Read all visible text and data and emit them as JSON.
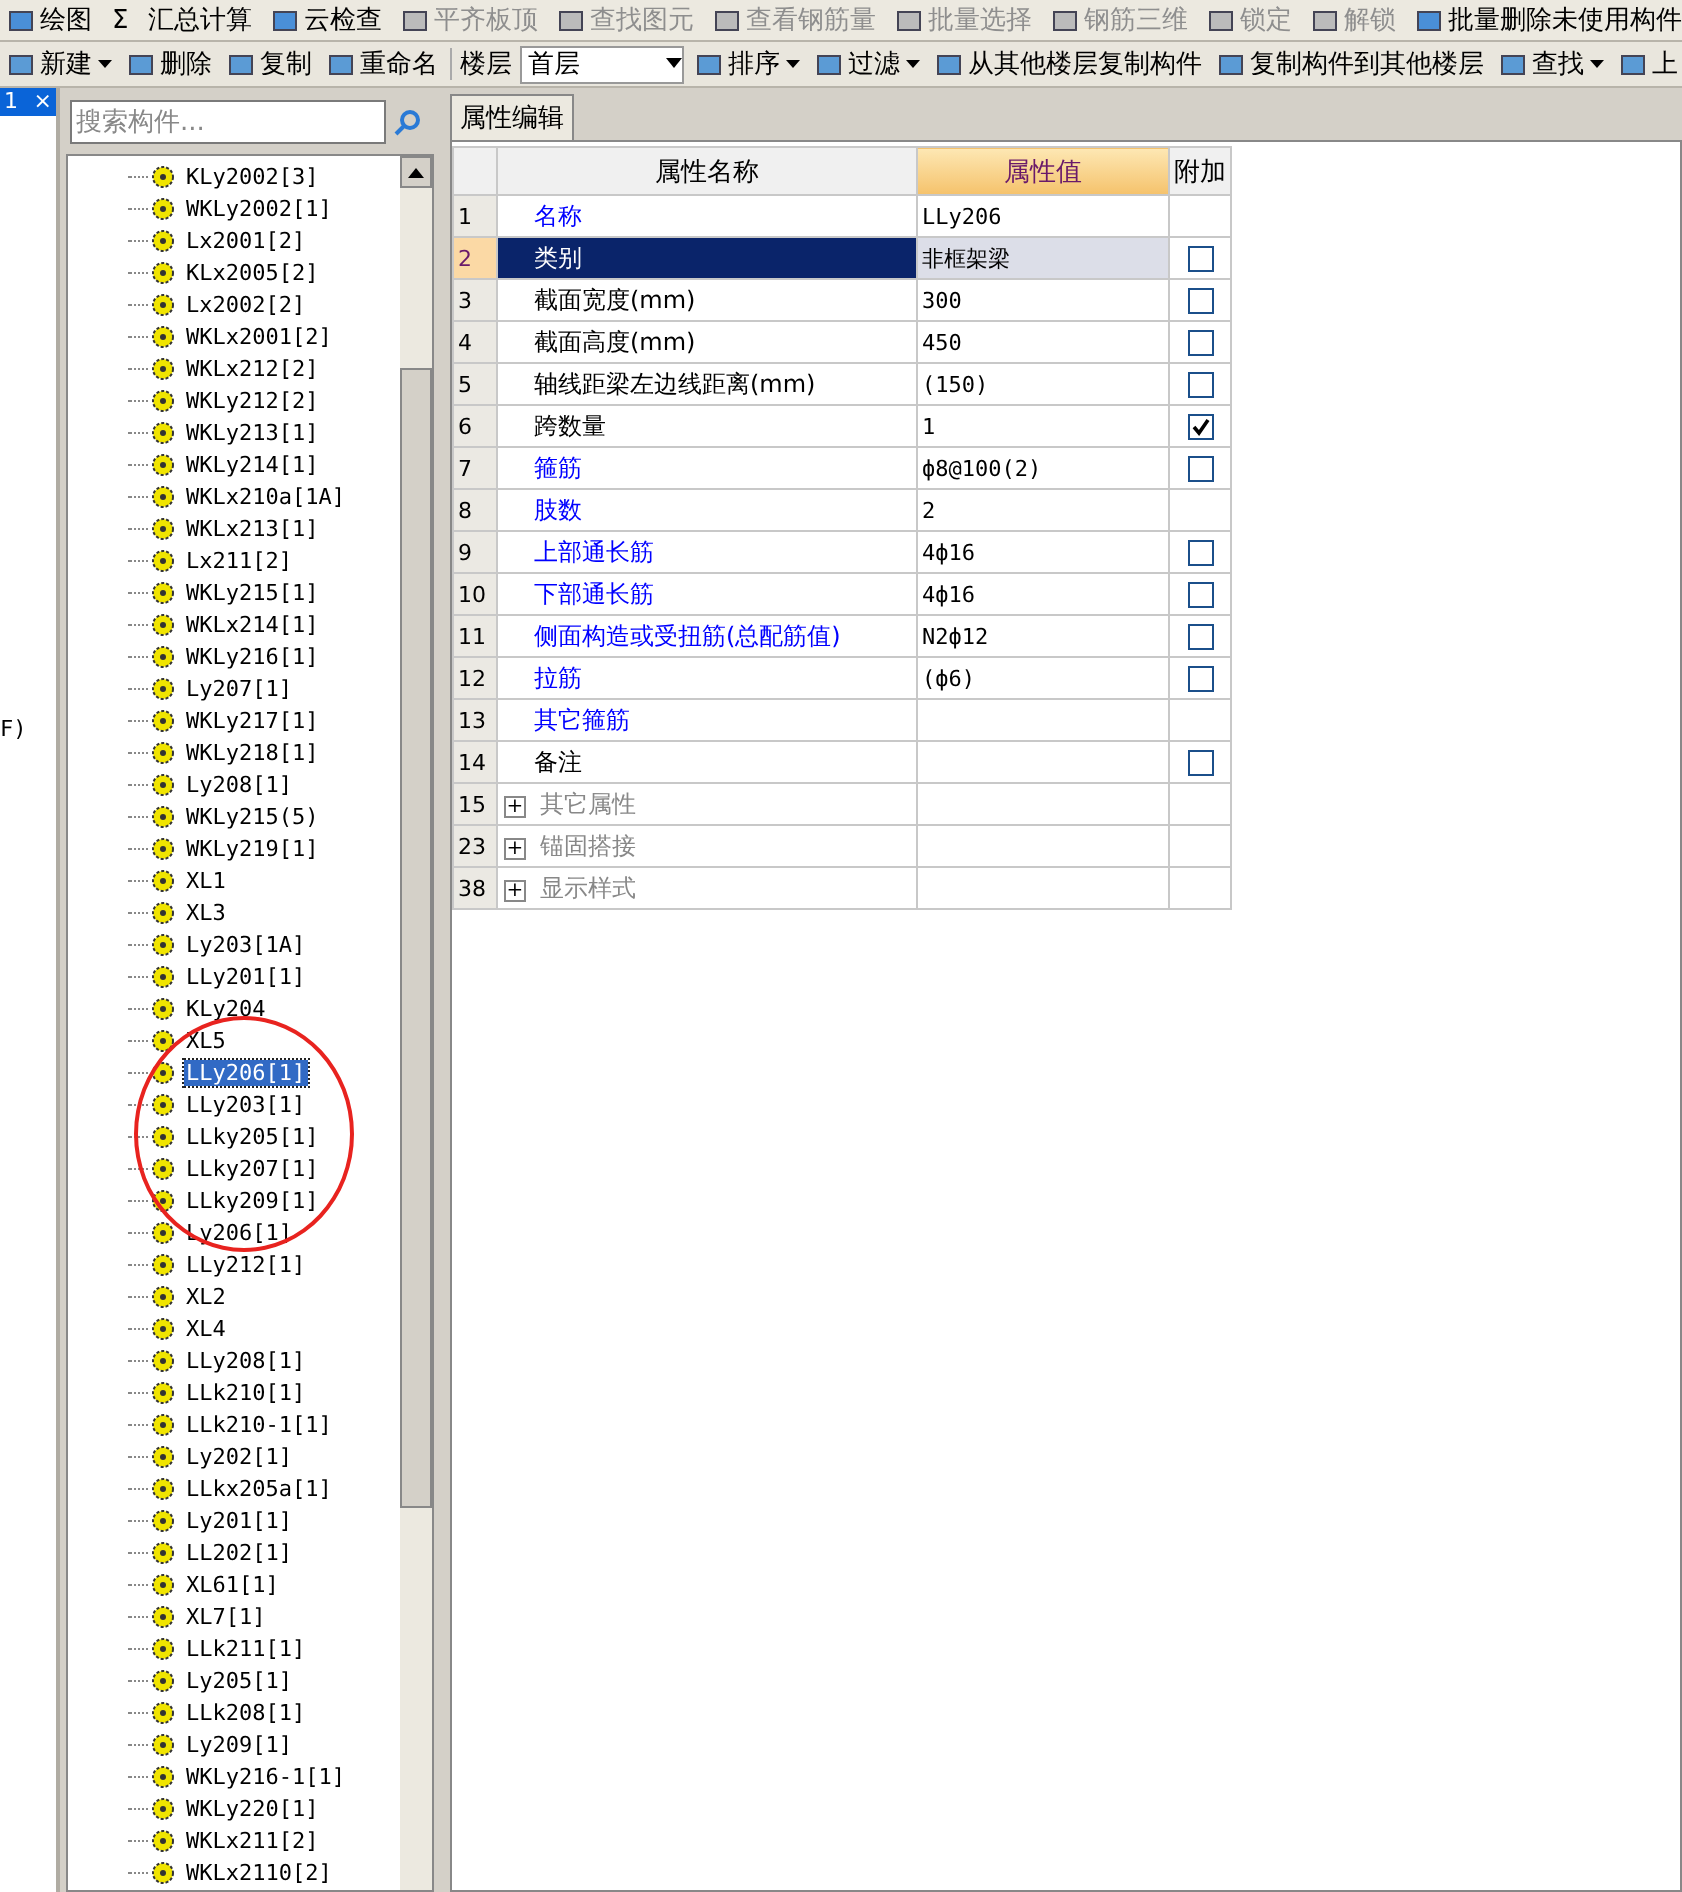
{
  "toolbar_top": [
    {
      "label": "绘图",
      "disabled": false
    },
    {
      "label": "Σ",
      "disabled": false,
      "kind": "glyph"
    },
    {
      "label": "汇总计算",
      "disabled": false
    },
    {
      "label": "云检查",
      "disabled": false
    },
    {
      "label": "平齐板顶",
      "disabled": true
    },
    {
      "label": "查找图元",
      "disabled": true
    },
    {
      "label": "查看钢筋量",
      "disabled": true
    },
    {
      "label": "批量选择",
      "disabled": true
    },
    {
      "label": "钢筋三维",
      "disabled": true
    },
    {
      "label": "锁定",
      "disabled": true
    },
    {
      "label": "解锁",
      "disabled": true
    },
    {
      "label": "批量删除未使用构件",
      "disabled": false
    }
  ],
  "toolbar": [
    {
      "label": "新建",
      "dropdown": true
    },
    {
      "label": "删除",
      "dropdown": false
    },
    {
      "label": "复制",
      "dropdown": false
    },
    {
      "label": "重命名",
      "dropdown": false
    },
    {
      "label": "楼层",
      "kind": "label"
    },
    {
      "label": "首层",
      "kind": "select"
    },
    {
      "label": "排序",
      "dropdown": true
    },
    {
      "label": "过滤",
      "dropdown": true
    },
    {
      "label": "从其他楼层复制构件",
      "dropdown": false
    },
    {
      "label": "复制构件到其他楼层",
      "dropdown": false
    },
    {
      "label": "查找",
      "dropdown": true
    },
    {
      "label": "上",
      "dropdown": false
    }
  ],
  "side_panel": {
    "tab": "1",
    "close": "×",
    "text": "F)"
  },
  "search": {
    "placeholder": "搜索构件..."
  },
  "tree_items": [
    {
      "label": "KLy2002[3]",
      "selected": false
    },
    {
      "label": "WKLy2002[1]",
      "selected": false
    },
    {
      "label": "Lx2001[2]",
      "selected": false
    },
    {
      "label": "KLx2005[2]",
      "selected": false
    },
    {
      "label": "Lx2002[2]",
      "selected": false
    },
    {
      "label": "WKLx2001[2]",
      "selected": false
    },
    {
      "label": "WKLx212[2]",
      "selected": false
    },
    {
      "label": "WKLy212[2]",
      "selected": false
    },
    {
      "label": "WKLy213[1]",
      "selected": false
    },
    {
      "label": "WKLy214[1]",
      "selected": false
    },
    {
      "label": "WKLx210a[1A]",
      "selected": false
    },
    {
      "label": "WKLx213[1]",
      "selected": false
    },
    {
      "label": "Lx211[2]",
      "selected": false
    },
    {
      "label": "WKLy215[1]",
      "selected": false
    },
    {
      "label": "WKLx214[1]",
      "selected": false
    },
    {
      "label": "WKLy216[1]",
      "selected": false
    },
    {
      "label": "Ly207[1]",
      "selected": false
    },
    {
      "label": "WKLy217[1]",
      "selected": false
    },
    {
      "label": "WKLy218[1]",
      "selected": false
    },
    {
      "label": "Ly208[1]",
      "selected": false
    },
    {
      "label": "WKLy215(5)",
      "selected": false
    },
    {
      "label": "WKLy219[1]",
      "selected": false
    },
    {
      "label": "XL1",
      "selected": false
    },
    {
      "label": "XL3",
      "selected": false
    },
    {
      "label": "Ly203[1A]",
      "selected": false
    },
    {
      "label": "LLy201[1]",
      "selected": false
    },
    {
      "label": "KLy204",
      "selected": false
    },
    {
      "label": "XL5",
      "selected": false
    },
    {
      "label": "LLy206[1]",
      "selected": true
    },
    {
      "label": "LLy203[1]",
      "selected": false
    },
    {
      "label": "LLky205[1]",
      "selected": false
    },
    {
      "label": "LLky207[1]",
      "selected": false
    },
    {
      "label": "LLky209[1]",
      "selected": false
    },
    {
      "label": "Ly206[1]",
      "selected": false
    },
    {
      "label": "LLy212[1]",
      "selected": false
    },
    {
      "label": "XL2",
      "selected": false
    },
    {
      "label": "XL4",
      "selected": false
    },
    {
      "label": "LLy208[1]",
      "selected": false
    },
    {
      "label": "LLk210[1]",
      "selected": false
    },
    {
      "label": "LLk210-1[1]",
      "selected": false
    },
    {
      "label": "Ly202[1]",
      "selected": false
    },
    {
      "label": "LLkx205a[1]",
      "selected": false
    },
    {
      "label": "Ly201[1]",
      "selected": false
    },
    {
      "label": "LL202[1]",
      "selected": false
    },
    {
      "label": "XL61[1]",
      "selected": false
    },
    {
      "label": "XL7[1]",
      "selected": false
    },
    {
      "label": "LLk211[1]",
      "selected": false
    },
    {
      "label": "Ly205[1]",
      "selected": false
    },
    {
      "label": "LLk208[1]",
      "selected": false
    },
    {
      "label": "Ly209[1]",
      "selected": false
    },
    {
      "label": "WKLy216-1[1]",
      "selected": false
    },
    {
      "label": "WKLy220[1]",
      "selected": false
    },
    {
      "label": "WKLx211[2]",
      "selected": false
    },
    {
      "label": "WKLx2110[2]",
      "selected": false
    }
  ],
  "properties_tab": "属性编辑",
  "properties": {
    "columns": [
      "属性名称",
      "属性值",
      "附加"
    ],
    "rows": [
      {
        "kind": "property",
        "number": "1",
        "name": "名称",
        "link": true,
        "value": "LLy206",
        "selected": false
      },
      {
        "kind": "property",
        "number": "2",
        "name": "类别",
        "link": false,
        "value": "非框架梁",
        "selected": true,
        "checked": false
      },
      {
        "kind": "property",
        "number": "3",
        "name": "截面宽度(mm)",
        "link": false,
        "value": "300",
        "selected": false,
        "checked": false
      },
      {
        "kind": "property",
        "number": "4",
        "name": "截面高度(mm)",
        "link": false,
        "value": "450",
        "selected": false,
        "checked": false
      },
      {
        "kind": "property",
        "number": "5",
        "name": "轴线距梁左边线距离(mm)",
        "link": false,
        "value": "(150)",
        "selected": false,
        "checked": false
      },
      {
        "kind": "property",
        "number": "6",
        "name": "跨数量",
        "link": false,
        "value": "1",
        "selected": false,
        "checked": true
      },
      {
        "kind": "property",
        "number": "7",
        "name": "箍筋",
        "link": true,
        "value": "ф8@100(2)",
        "selected": false,
        "checked": false
      },
      {
        "kind": "property",
        "number": "8",
        "name": "肢数",
        "link": true,
        "value": "2",
        "selected": false
      },
      {
        "kind": "property",
        "number": "9",
        "name": "上部通长筋",
        "link": true,
        "value": "4ф16",
        "selected": false,
        "checked": false
      },
      {
        "kind": "property",
        "number": "10",
        "name": "下部通长筋",
        "link": true,
        "value": "4ф16",
        "selected": false,
        "checked": false
      },
      {
        "kind": "property",
        "number": "11",
        "name": "侧面构造或受扭筋(总配筋值)",
        "link": true,
        "value": "N2ф12",
        "selected": false,
        "checked": false
      },
      {
        "kind": "property",
        "number": "12",
        "name": "拉筋",
        "link": true,
        "value": "(ф6)",
        "selected": false,
        "checked": false
      },
      {
        "kind": "property",
        "number": "13",
        "name": "其它箍筋",
        "link": true,
        "value": "",
        "selected": false
      },
      {
        "kind": "property",
        "number": "14",
        "name": "备注",
        "link": false,
        "value": "",
        "selected": false,
        "checked": false
      },
      {
        "kind": "group",
        "number": "15",
        "name": "其它属性",
        "expander": "+"
      },
      {
        "kind": "group",
        "number": "23",
        "name": "锚固搭接",
        "expander": "+"
      },
      {
        "kind": "group",
        "number": "38",
        "name": "显示样式",
        "expander": "+"
      }
    ]
  }
}
